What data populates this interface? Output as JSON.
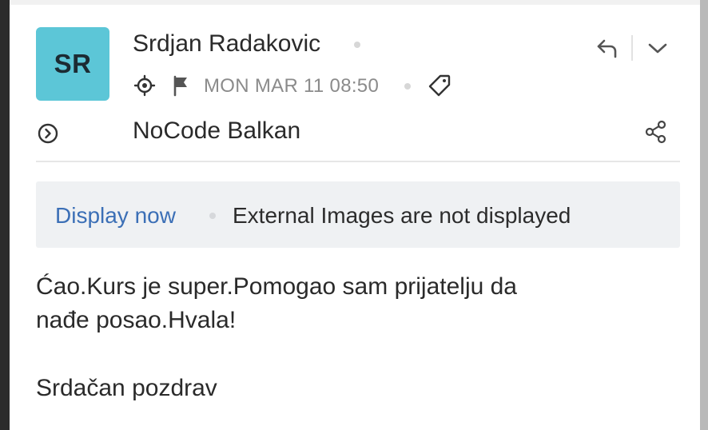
{
  "header": {
    "avatar_initials": "SR",
    "avatar_color": "#5cc6d7",
    "sender_name": "Srdjan Radakovic",
    "date": "MON MAR 11 08:50",
    "account": "NoCode Balkan",
    "icons": [
      "reply-icon",
      "chevron-down-icon",
      "target-icon",
      "flag-icon",
      "tag-icon",
      "expand-circle-icon",
      "share-icon"
    ]
  },
  "notice": {
    "action_label": "Display now",
    "message": "External Images are not displayed",
    "link_color": "#3b6fb6"
  },
  "body": {
    "lines": [
      "Ćao.Kurs je super.Pomogao sam prijatelju da",
      "nađe posao.Hvala!"
    ],
    "signoff": "Srdačan pozdrav"
  }
}
